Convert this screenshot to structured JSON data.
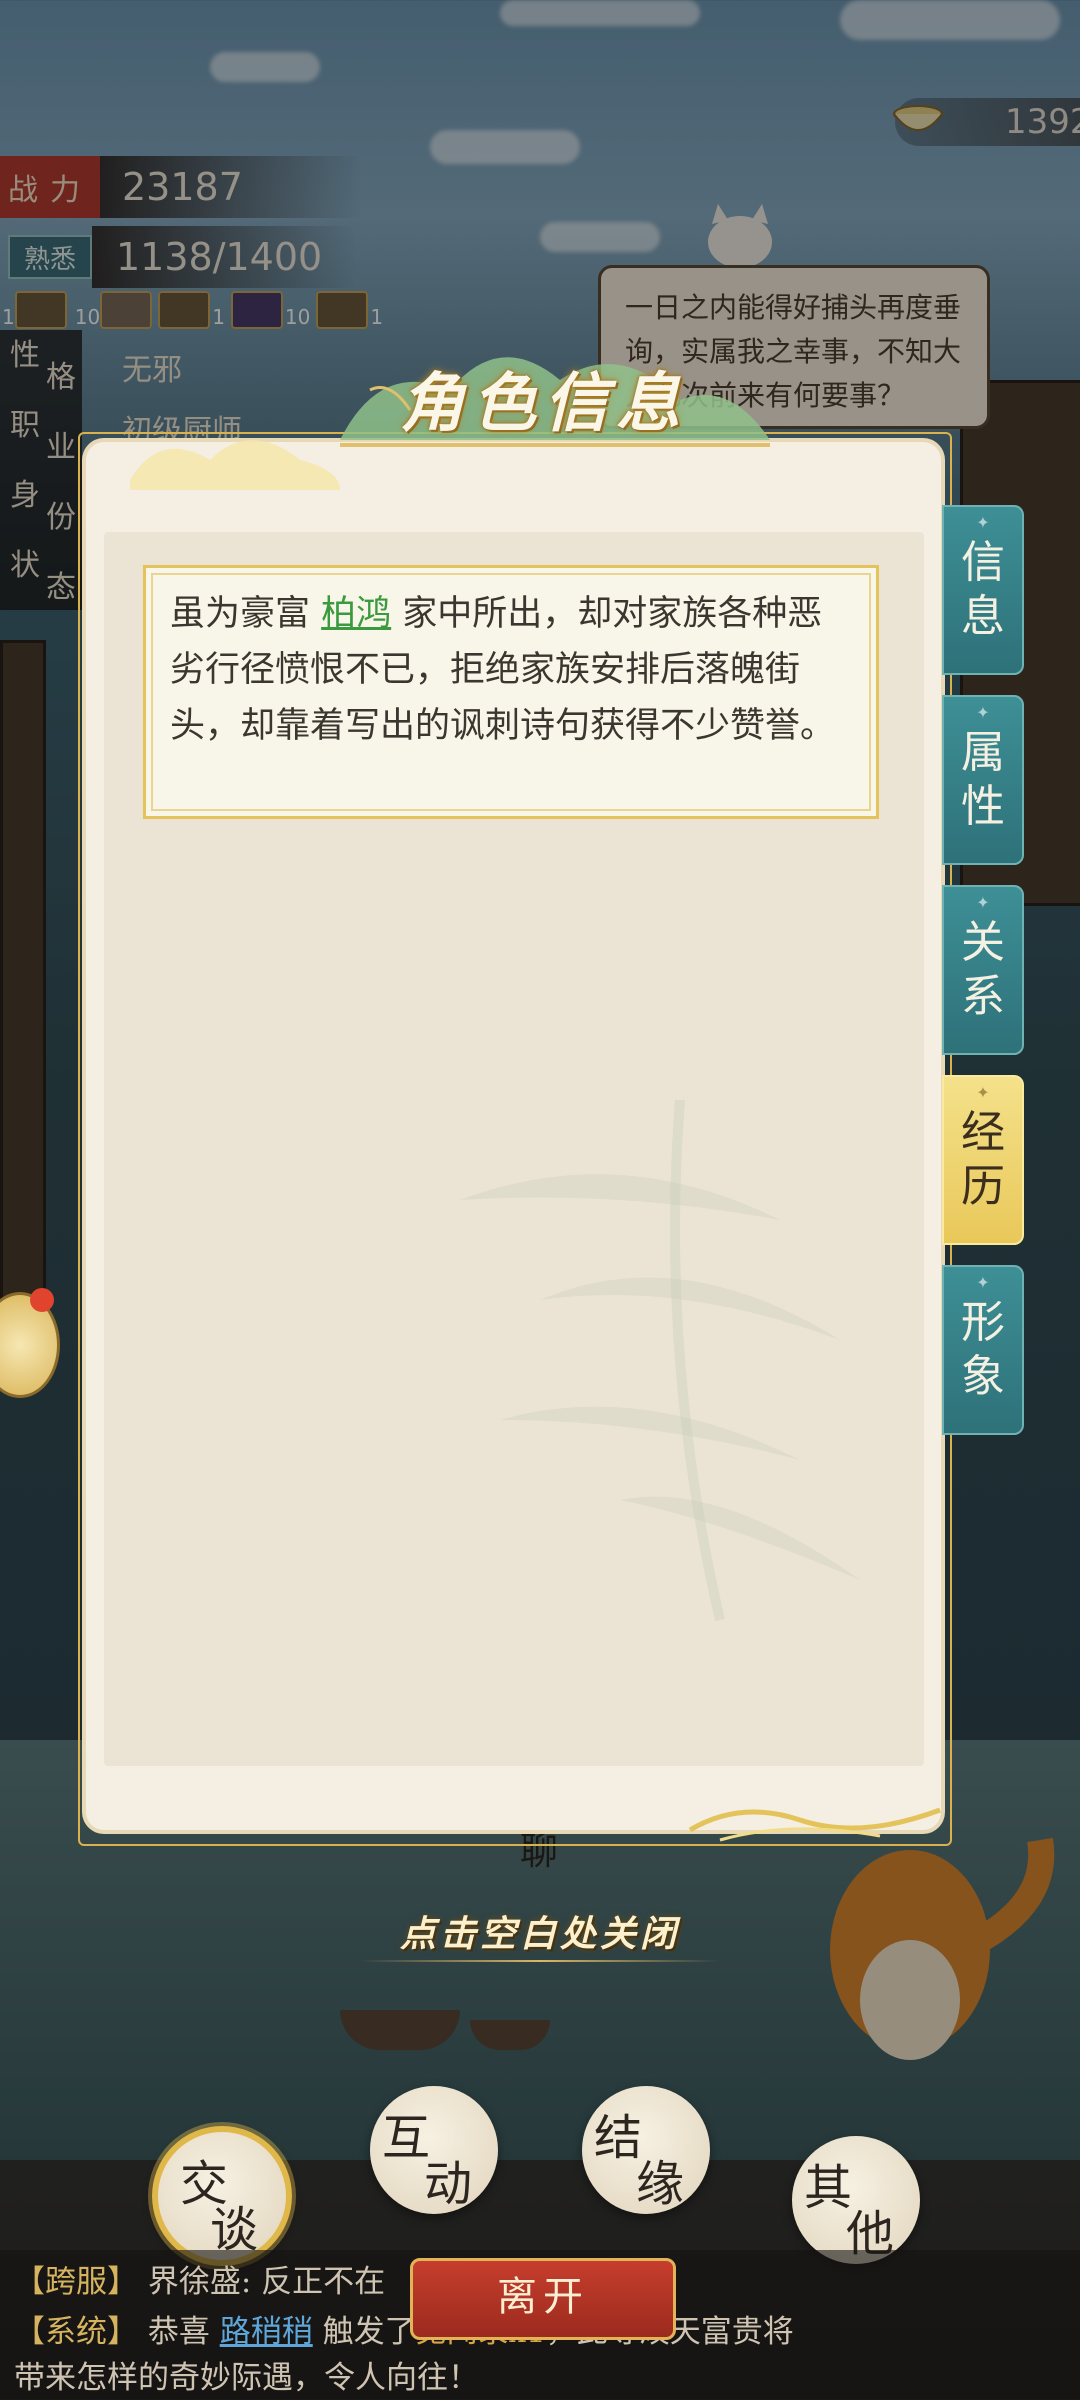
{
  "stats": {
    "power_label": "战力",
    "power_value": "23187",
    "familiar_label": "熟悉",
    "familiar_value": "1138/1400",
    "items": [
      {
        "icon": "scroll-icon",
        "count": "1"
      },
      {
        "icon": "brush-icon",
        "count": "10"
      },
      {
        "icon": "scroll-icon",
        "count": "1"
      },
      {
        "icon": "gem-icon",
        "count": "10"
      },
      {
        "icon": "scroll-icon",
        "count": "1"
      }
    ],
    "traits": [
      {
        "label_a": "性",
        "label_b": "格",
        "value": "无邪"
      },
      {
        "label_a": "职",
        "label_b": "业",
        "value": "初级厨师"
      },
      {
        "label_a": "身",
        "label_b": "份",
        "value": ""
      },
      {
        "label_a": "状",
        "label_b": "态",
        "value": ""
      }
    ]
  },
  "currency": {
    "icon": "bowl-icon",
    "value": "1392"
  },
  "bubble": {
    "text": "一日之内能得好捕头再度垂询，实属我之幸事，不知大人此次前来有何要事？"
  },
  "modal": {
    "title": "角色信息",
    "description_before": "虽为豪富 ",
    "description_link": "柏鸿",
    "description_after": " 家中所出，却对家族各种恶劣行径愤恨不已，拒绝家族安排后落魄街头，却靠着写出的讽刺诗句获得不少赞誉。",
    "tabs": [
      {
        "c1": "信",
        "c2": "息",
        "active": false
      },
      {
        "c1": "属",
        "c2": "性",
        "active": false
      },
      {
        "c1": "关",
        "c2": "系",
        "active": false
      },
      {
        "c1": "经",
        "c2": "历",
        "active": true
      },
      {
        "c1": "形",
        "c2": "象",
        "active": false
      }
    ],
    "close_hint": "点击空白处关闭"
  },
  "behind_text": "聊",
  "actions": [
    {
      "a": "交",
      "b": "谈"
    },
    {
      "a": "互",
      "b": "动"
    },
    {
      "a": "结",
      "b": "缘"
    },
    {
      "a": "其",
      "b": "他"
    }
  ],
  "leave_label": "离开",
  "chat": {
    "line1_tag": "【跨服】",
    "line1_text": "界徐盛: 反正不在",
    "line2_tag": "【系统】",
    "line2_text_a": "恭喜",
    "line2_link": "路稍稍",
    "line2_text_b": "触发了",
    "line2_item": "见闻录x1",
    "line2_text_c": "，此等泼天富贵将",
    "line3_text": "带来怎样的奇妙际遇，令人向往！"
  },
  "colors": {
    "accent_gold": "#e3c35a",
    "tab_teal": "#2e7179",
    "tab_active": "#e9c85a",
    "link_green": "#3b9a3e",
    "leave_red": "#b43a31"
  }
}
